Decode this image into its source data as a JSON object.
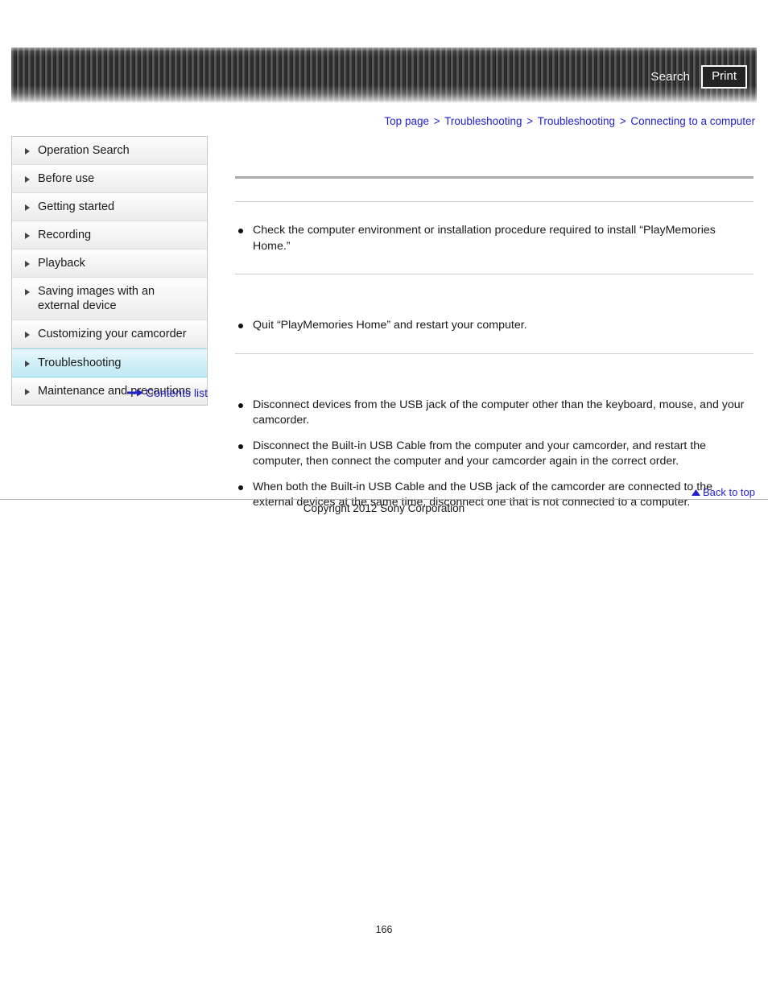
{
  "header": {
    "search_label": "Search",
    "print_label": "Print"
  },
  "breadcrumb": {
    "separator": ">",
    "items": [
      {
        "label": "Top page"
      },
      {
        "label": "Troubleshooting"
      },
      {
        "label": "Troubleshooting"
      },
      {
        "label": "Connecting to a computer"
      }
    ]
  },
  "sidebar": {
    "items": [
      {
        "label": "Operation Search",
        "active": false
      },
      {
        "label": "Before use",
        "active": false
      },
      {
        "label": "Getting started",
        "active": false
      },
      {
        "label": "Recording",
        "active": false
      },
      {
        "label": "Playback",
        "active": false
      },
      {
        "label": "Saving images with an external device",
        "active": false
      },
      {
        "label": "Customizing your camcorder",
        "active": false
      },
      {
        "label": "Troubleshooting",
        "active": true
      },
      {
        "label": "Maintenance and precautions",
        "active": false
      }
    ],
    "contents_link": "Contents list"
  },
  "main": {
    "page_title": "",
    "sections": [
      {
        "heading": "",
        "bullets": [
          "Check the computer environment or installation procedure required to install “PlayMemories Home.”"
        ]
      },
      {
        "heading": "",
        "bullets": [
          "Quit “PlayMemories Home” and restart your computer."
        ]
      },
      {
        "heading": "",
        "bullets": [
          "Disconnect devices from the USB jack of the computer other than the keyboard, mouse, and your camcorder.",
          "Disconnect the Built-in USB Cable from the computer and your camcorder, and restart the computer, then connect the computer and your camcorder again in the correct order.",
          "When both the Built-in USB Cable and the USB jack of the camcorder are connected to the external devices at the same time, disconnect one that is not connected to a computer."
        ]
      }
    ],
    "back_to_top": "Back to top"
  },
  "footer": {
    "copyright": "Copyright 2012 Sony Corporation",
    "page_number": "166"
  },
  "colors": {
    "link": "#2222cc",
    "active_nav": "#cdeef7",
    "header_dark": "#2b2b2b"
  }
}
